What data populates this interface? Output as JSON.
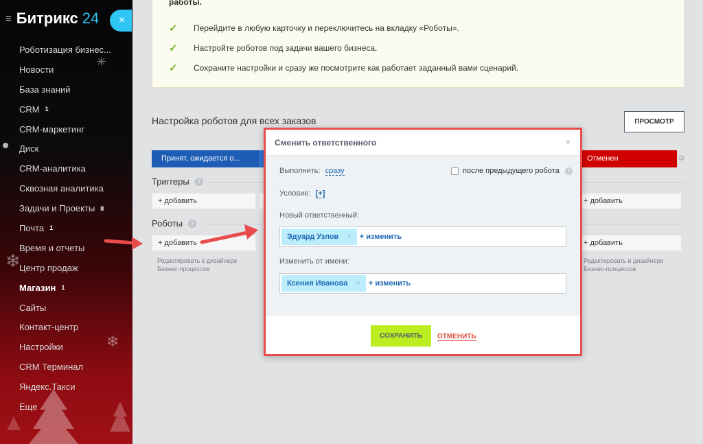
{
  "sidebar": {
    "logo_text": "Битрикс",
    "logo_num": "24",
    "toggle_icon": "×",
    "items": [
      {
        "label": "Роботизация бизнес...",
        "count": ""
      },
      {
        "label": "Новости",
        "count": ""
      },
      {
        "label": "База знаний",
        "count": ""
      },
      {
        "label": "CRM",
        "count": "1"
      },
      {
        "label": "CRM-маркетинг",
        "count": ""
      },
      {
        "label": "Диск",
        "count": ""
      },
      {
        "label": "CRM-аналитика",
        "count": ""
      },
      {
        "label": "Сквозная аналитика",
        "count": ""
      },
      {
        "label": "Задачи и Проекты",
        "count": "8"
      },
      {
        "label": "Почта",
        "count": "1"
      },
      {
        "label": "Время и отчеты",
        "count": ""
      },
      {
        "label": "Центр продаж",
        "count": ""
      },
      {
        "label": "Магазин",
        "count": "1"
      },
      {
        "label": "Сайты",
        "count": ""
      },
      {
        "label": "Контакт-центр",
        "count": ""
      },
      {
        "label": "Настройки",
        "count": ""
      },
      {
        "label": "CRM Терминал",
        "count": ""
      },
      {
        "label": "Яндекс.Такси",
        "count": ""
      },
      {
        "label": "Еще",
        "count": ""
      }
    ]
  },
  "tips": {
    "title": "работы.",
    "items": [
      "Перейдите в любую карточку и переключитесь на вкладку «Роботы».",
      "Настройте роботов под задачи вашего бизнеса.",
      "Сохраните настройки и сразу же посмотрите как работает заданный вами сценарий."
    ]
  },
  "main": {
    "section_title": "Настройка роботов для всех заказов",
    "preview_label": "ПРОСМОТР",
    "stage_first": "Принят, ожидается о...",
    "stage_last": "Отменен",
    "triggers_label": "Триггеры",
    "robots_label": "Роботы",
    "add_label": "+ добавить",
    "hint_line1": "Редактировать в дизайнере",
    "hint_line2": "Бизнес-процессов"
  },
  "modal": {
    "title": "Сменить ответственного",
    "close": "×",
    "run_label": "Выполнить:",
    "run_value": "сразу",
    "after_prev_label": "после предыдущего робота",
    "condition_label": "Условие:",
    "condition_value": "[+]",
    "new_resp_label": "Новый ответственный:",
    "new_resp_value": "Эдуард Узлов",
    "change_from_label": "Изменить от имени:",
    "change_from_value": "Ксения Иванова",
    "change_link": "+ изменить",
    "save_label": "СОХРАНИТЬ",
    "cancel_label": "ОТМЕНИТЬ"
  },
  "colors": {
    "accent": "#2fc6f6",
    "highlight_border": "#e94c4c",
    "save_button": "#bbed21",
    "stage_blue": "#1d5db5",
    "stage_red": "#d10000"
  }
}
